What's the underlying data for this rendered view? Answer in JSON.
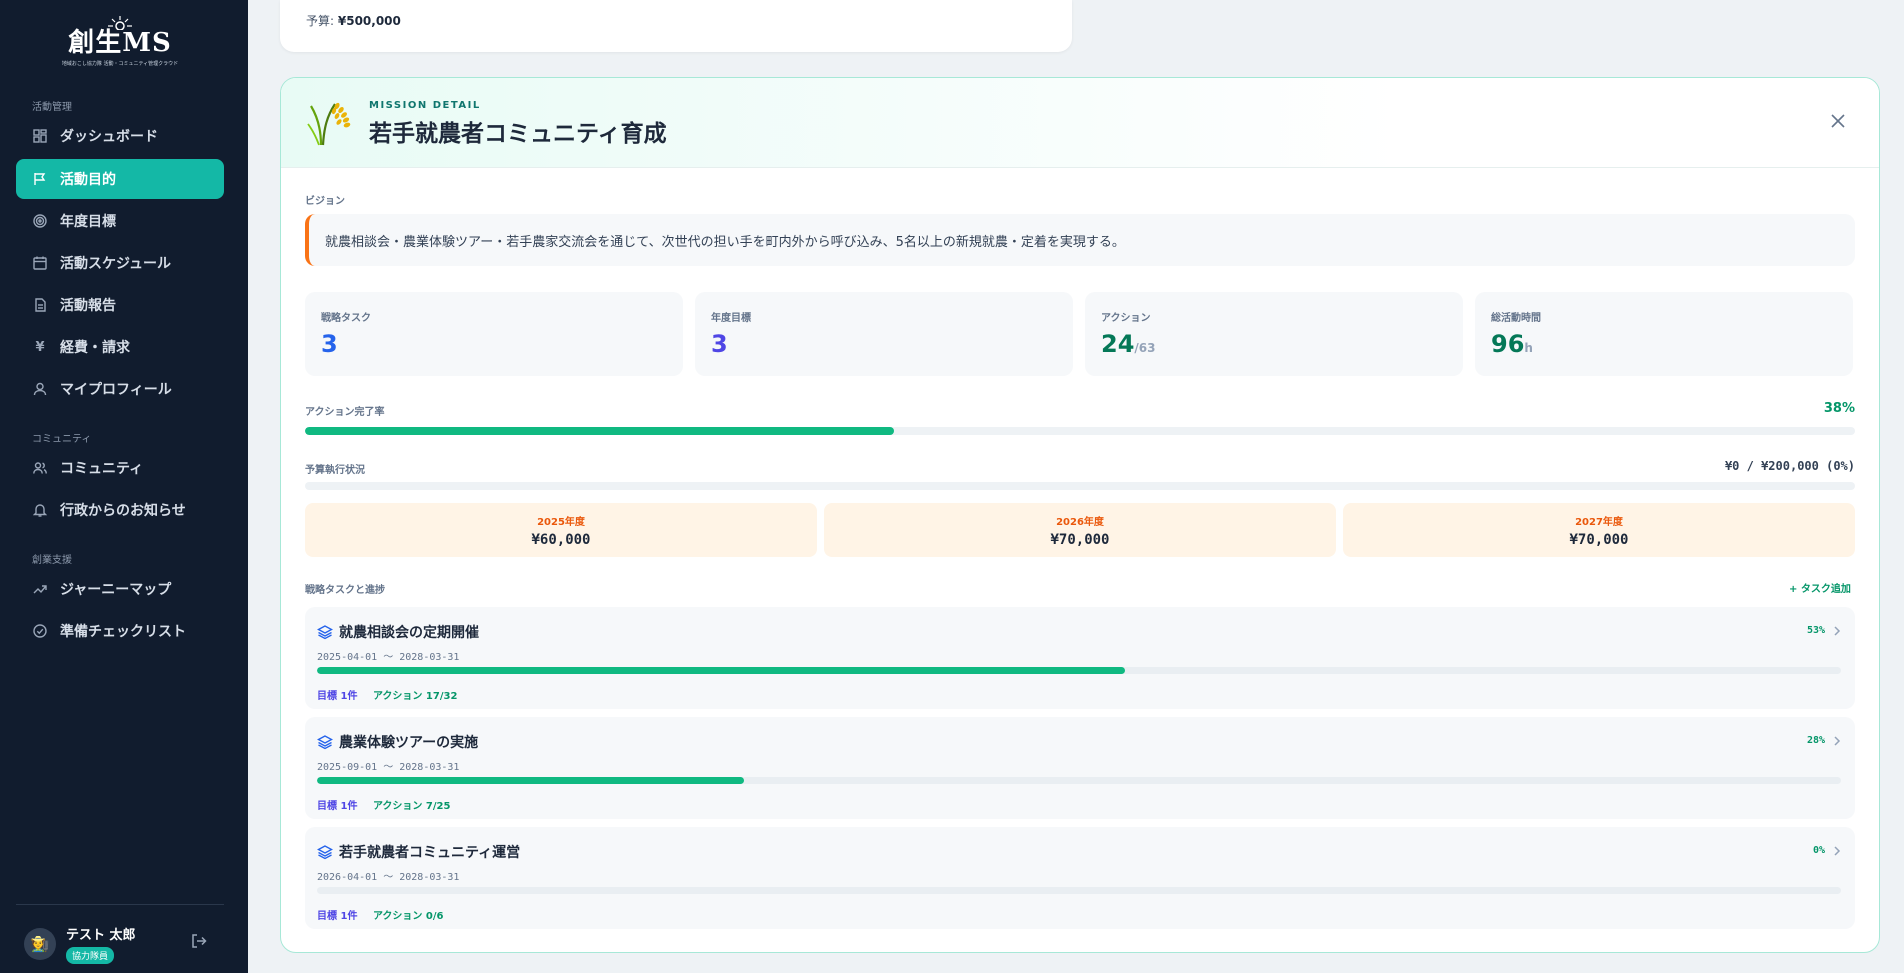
{
  "sidebar": {
    "logo_text": "創生MS",
    "logo_sub": "地域おこし協力隊 活動・コミュニティ管理クラウド",
    "sections": [
      "活動管理",
      "コミュニティ",
      "創業支援"
    ],
    "items": [
      {
        "label": "ダッシュボード",
        "icon": "dashboard-icon"
      },
      {
        "label": "活動目的",
        "icon": "flag-icon"
      },
      {
        "label": "年度目標",
        "icon": "target-icon"
      },
      {
        "label": "活動スケジュール",
        "icon": "calendar-icon"
      },
      {
        "label": "活動報告",
        "icon": "document-icon"
      },
      {
        "label": "経費・請求",
        "icon": "yen-icon"
      },
      {
        "label": "マイプロフィール",
        "icon": "user-icon"
      },
      {
        "label": "コミュニティ",
        "icon": "users-icon"
      },
      {
        "label": "行政からのお知らせ",
        "icon": "bell-icon"
      },
      {
        "label": "ジャーニーマップ",
        "icon": "trend-icon"
      },
      {
        "label": "準備チェックリスト",
        "icon": "check-circle-icon"
      }
    ],
    "active_index": 1,
    "user": {
      "name": "テスト 太郎",
      "role": "協力隊員",
      "avatar": "🧑‍🌾"
    }
  },
  "prev_card": {
    "budget_label": "予算:",
    "budget_value": "¥500,000"
  },
  "detail": {
    "eyebrow": "MISSION DETAIL",
    "title": "若手就農者コミュニティ育成",
    "vision_label": "ビジョン",
    "vision": "就農相談会・農業体験ツアー・若手農家交流会を通じて、次世代の担い手を町内外から呼び込み、5名以上の新規就農・定着を実現する。",
    "stats": [
      {
        "label": "戦略タスク",
        "value": "3",
        "unit": "",
        "color": "#2563eb"
      },
      {
        "label": "年度目標",
        "value": "3",
        "unit": "",
        "color": "#4f46e5"
      },
      {
        "label": "アクション",
        "value": "24",
        "unit": "/63",
        "color": "#047857"
      },
      {
        "label": "総活動時間",
        "value": "96",
        "unit": "h",
        "color": "#047857"
      }
    ],
    "completion": {
      "label": "アクション完了率",
      "pct_text": "38%",
      "fill_fraction": 0.38
    },
    "budget": {
      "label": "予算執行状況",
      "summary": "¥0 / ¥200,000 (0%)",
      "fill_fraction": 0.0
    },
    "years": [
      {
        "label": "2025年度",
        "value": "¥60,000"
      },
      {
        "label": "2026年度",
        "value": "¥70,000"
      },
      {
        "label": "2027年度",
        "value": "¥70,000"
      }
    ],
    "tasks_label": "戦略タスクと進捗",
    "add_task": "タスク追加",
    "tasks": [
      {
        "title": "就農相談会の定期開催",
        "date": "2025-04-01 〜 2028-03-31",
        "pct_text": "53%",
        "fraction": 0.53,
        "goal": "目標 1件",
        "actions": "アクション 17/32"
      },
      {
        "title": "農業体験ツアーの実施",
        "date": "2025-09-01 〜 2028-03-31",
        "pct_text": "28%",
        "fraction": 0.28,
        "goal": "目標 1件",
        "actions": "アクション 7/25"
      },
      {
        "title": "若手就農者コミュニティ運営",
        "date": "2026-04-01 〜 2028-03-31",
        "pct_text": "0%",
        "fraction": 0.0,
        "goal": "目標 1件",
        "actions": "アクション 0/6"
      }
    ]
  }
}
